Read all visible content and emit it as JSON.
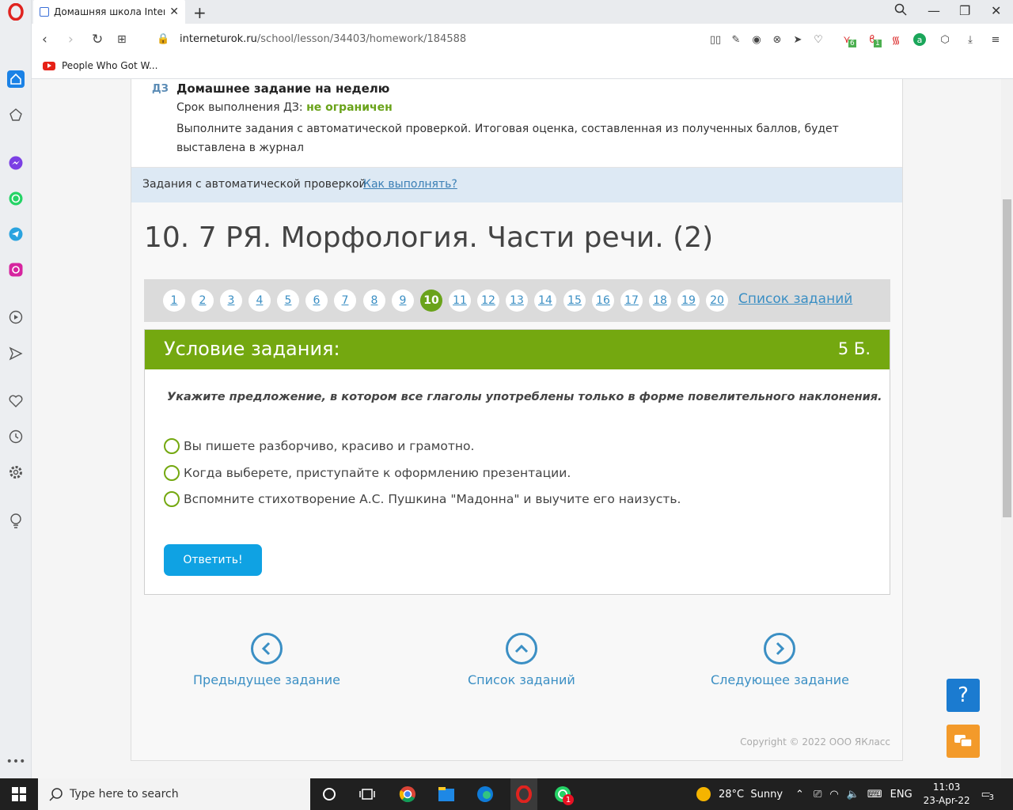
{
  "browser": {
    "tab_title": "Домашняя школа InternetUrok",
    "url_host": "interneturok.ru",
    "url_path": "/school/lesson/34403/homework/184588",
    "bookmark": "People Who Got W..."
  },
  "homework": {
    "label": "ДЗ",
    "title": "Домашнее задание на неделю",
    "deadline_prefix": "Срок выполнения ДЗ: ",
    "deadline_value": "не ограничен",
    "description": "Выполните задания с автоматической проверкой. Итоговая оценка, составленная из полученных баллов, будет выставлена в журнал"
  },
  "auto_check": {
    "text": "Задания с автоматической проверкой",
    "link": "Как выполнять?"
  },
  "test_title": "10. 7 РЯ. Морфология. Части речи. (2)",
  "task_nav": {
    "numbers": [
      "1",
      "2",
      "3",
      "4",
      "5",
      "6",
      "7",
      "8",
      "9",
      "10",
      "11",
      "12",
      "13",
      "14",
      "15",
      "16",
      "17",
      "18",
      "19",
      "20"
    ],
    "active": "10",
    "list_link": "Список заданий"
  },
  "condition": {
    "title": "Условие задания:",
    "points": "5 Б.",
    "question": "Укажите предложение, в котором все глаголы употреблены только в форме повелительного наклонения.",
    "options": [
      "Вы пишете разборчиво, красиво и грамотно.",
      "Когда выберете, приступайте к оформлению презентации.",
      "Вспомните стихотворение А.С. Пушкина \"Мадонна\" и выучите его наизусть."
    ],
    "answer_button": "Ответить!"
  },
  "bottom_nav": {
    "prev": "Предыдущее задание",
    "list": "Список заданий",
    "next": "Следующее задание"
  },
  "copyright": "Copyright © 2022 ООО ЯКласс",
  "help_label": "?",
  "taskbar": {
    "search_placeholder": "Type here to search",
    "weather": "28°C  Sunny",
    "lang": "ENG",
    "time": "11:03",
    "date": "23-Apr-22",
    "notif_count": "3",
    "whatsapp_badge": "1"
  },
  "ext_badges": {
    "first": "6",
    "second": "1"
  },
  "colors": {
    "accent_green": "#74a810",
    "link_blue": "#3b8fc4",
    "button_blue": "#0fa2e3",
    "help_blue": "#1b7bd0",
    "chat_orange": "#f39a2a"
  }
}
